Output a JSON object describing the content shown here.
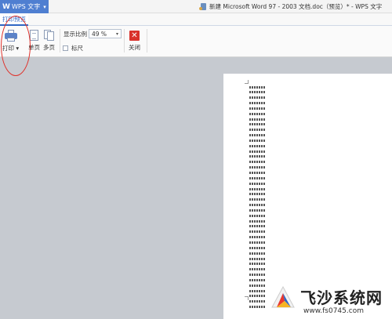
{
  "titlebar": {
    "app_name": "WPS 文字",
    "app_logo": "W",
    "document_title": "新建 Microsoft Word 97 - 2003 文档.doc（预览）* - WPS 文字"
  },
  "tabs": [
    {
      "label": "打印预览",
      "active": true
    }
  ],
  "ribbon": {
    "print_label": "打印",
    "single_page_label": "单页",
    "multi_page_label": "多页",
    "zoom_label": "显示比例",
    "zoom_value": "49 %",
    "ruler_label": "标尺",
    "ruler_checked": false,
    "close_label": "关闭"
  },
  "document": {
    "line_count": 42
  },
  "annotation": {
    "color": "#e0312a"
  },
  "watermark": {
    "main_text": "飞沙系统网",
    "url": "www.fs0745.com"
  },
  "colors": {
    "accent": "#2f66c4",
    "app_button": "#4f7fd1",
    "workspace": "#c6cad0",
    "close": "#d9322b"
  }
}
